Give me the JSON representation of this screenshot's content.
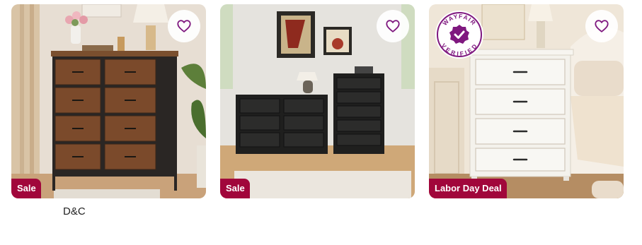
{
  "products": [
    {
      "badge": "Sale",
      "favorite_icon": "heart-outline-icon",
      "brand": "D&C"
    },
    {
      "badge": "Sale",
      "favorite_icon": "heart-outline-icon"
    },
    {
      "badge": "Labor Day Deal",
      "favorite_icon": "heart-outline-icon",
      "verified_badge": {
        "top_text": "WAYFAIR",
        "bottom_text": "VERIFIED"
      }
    }
  ],
  "colors": {
    "badge_bg": "#a1063b",
    "icon": "#7f187f"
  }
}
